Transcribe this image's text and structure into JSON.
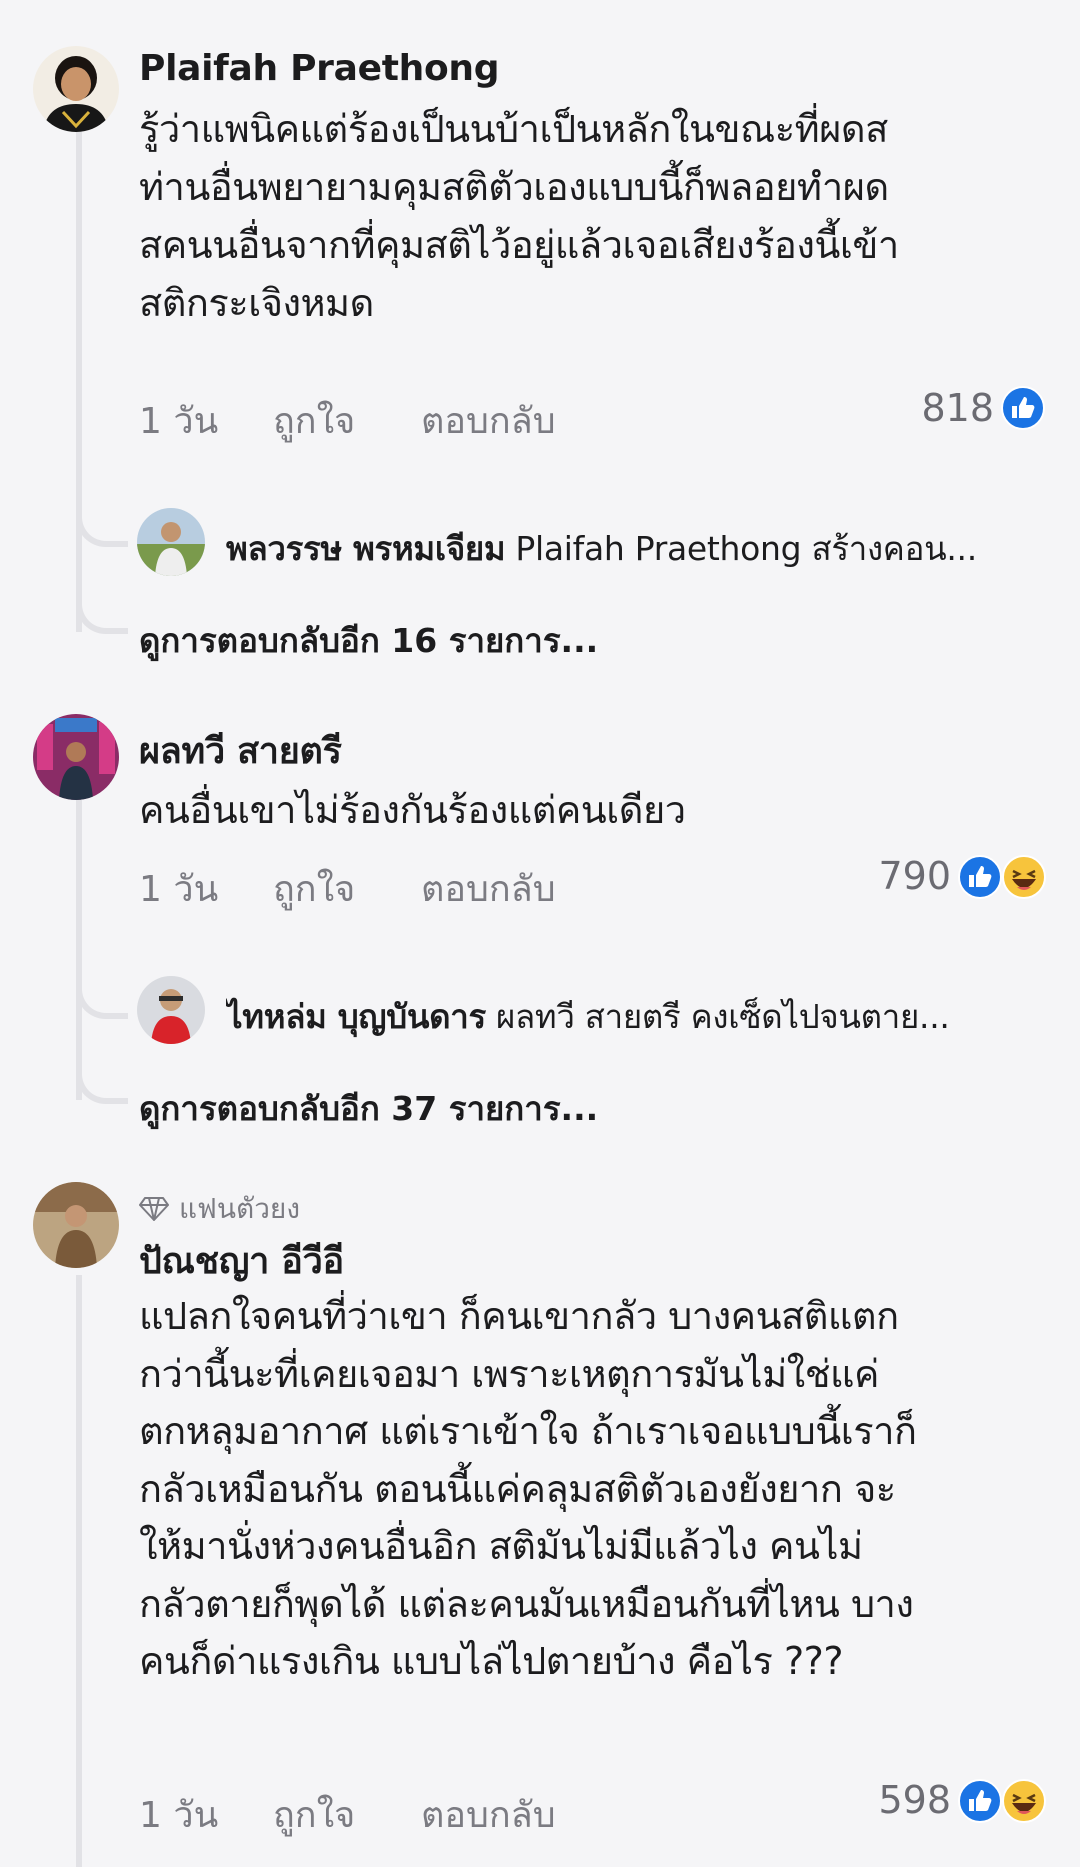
{
  "comments": [
    {
      "author": "Plaifah Praethong",
      "text": "รู้ว่าแพนิคแต่ร้องเป็นนบ้าเป็นหลักในขณะที่ผดส\nท่านอื่นพยายามคุมสติตัวเองแบบนี้ก็พลอยทำผด\nสคนนอื่นจากที่คุมสติไว้อยู่แล้วเจอเสียงร้องนี้เข้า\nสติกระเจิงหมด",
      "time": "1 วัน",
      "like_label": "ถูกใจ",
      "reply_label": "ตอบกลับ",
      "reaction_count": "818",
      "reply_preview": {
        "author": "พลวรรษ พรหมเจียม",
        "text": "Plaifah Praethong สร้างคอน..."
      },
      "more_replies": "ดูการตอบกลับอีก 16 รายการ..."
    },
    {
      "author": "ผลทวี สายตรี",
      "text": "คนอื่นเขาไม่ร้องกันร้องแต่คนเดียว",
      "time": "1 วัน",
      "like_label": "ถูกใจ",
      "reply_label": "ตอบกลับ",
      "reaction_count": "790",
      "reply_preview": {
        "author": "ไทหล่ม บุญบันดาร",
        "text": "ผลทวี สายตรี คงเซ็ดไปจนตาย..."
      },
      "more_replies": "ดูการตอบกลับอีก 37 รายการ..."
    },
    {
      "badge": "แฟนตัวยง",
      "author": "ปัณชญา อีวีอี",
      "text": "แปลกใจคนที่ว่าเขา ก็คนเขากลัว บางคนสติแตก\nกว่านี้นะที่เคยเจอมา เพราะเหตุการมันไม่ใช่แค่\nตกหลุมอากาศ แต่เราเข้าใจ ถ้าเราเจอแบบนี้เราก็\nกลัวเหมือนกัน ตอนนี้แค่คลุมสติตัวเองยังยาก จะ\nให้มานั่งห่วงคนอื่นอิก สติมันไม่มีแล้วไง คนไม่\nกลัวตายก็พุดได้ แต่ละคนมันเหมือนกันที่ไหน บาง\nคนก็ด่าแรงเกิน แบบไล่ไปตายบ้าง คือไร ???",
      "time": "1 วัน",
      "like_label": "ถูกใจ",
      "reply_label": "ตอบกลับ",
      "reaction_count": "598"
    }
  ],
  "icons": {
    "like": "like-thumb-icon",
    "haha": "haha-emoji-icon",
    "badge": "diamond-badge-icon"
  },
  "colors": {
    "like_blue": "#1b74e4",
    "haha_yellow": "#f7c43c",
    "thread_line": "#e2e2e6",
    "muted_text": "#7b7b82"
  }
}
